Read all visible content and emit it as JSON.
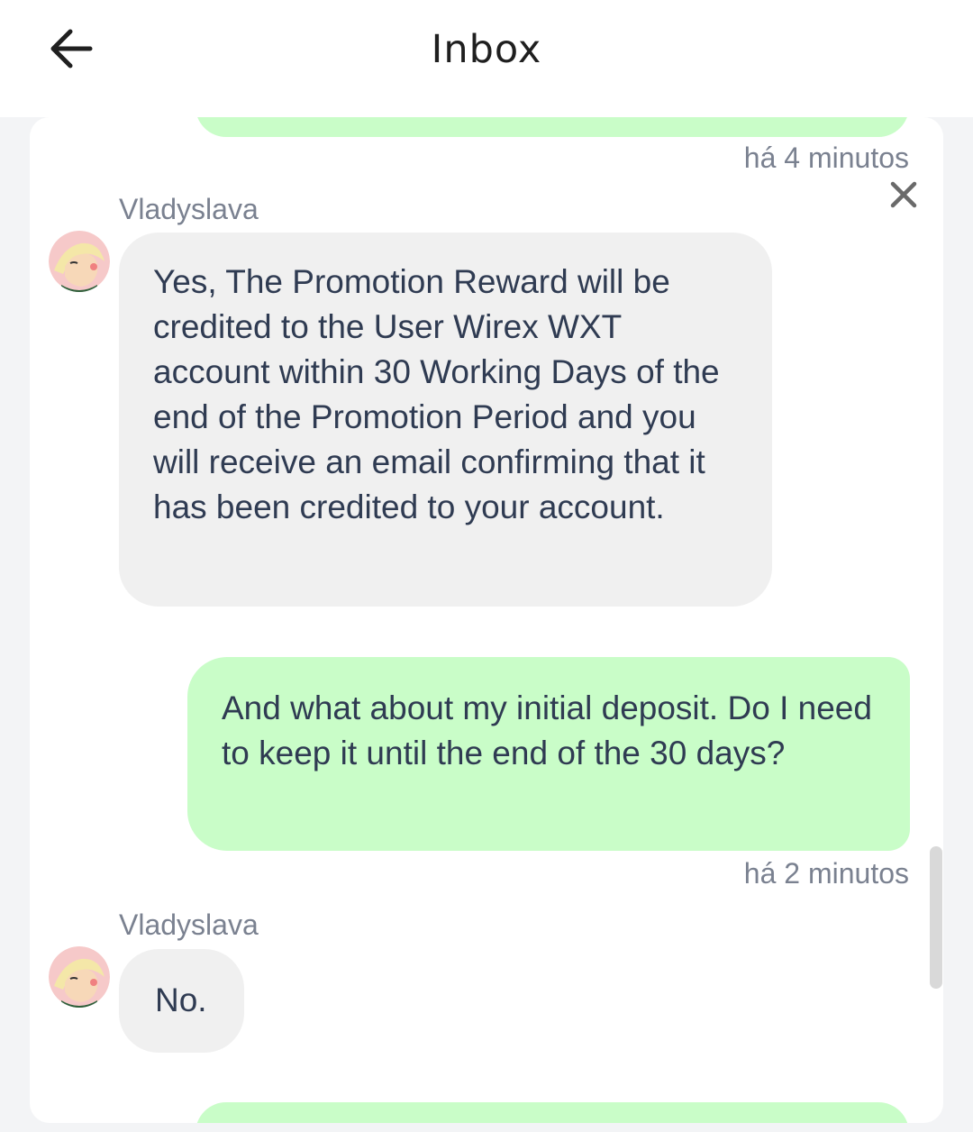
{
  "header": {
    "title": "Inbox",
    "back_icon": "arrow-left-icon"
  },
  "messages": [
    {
      "type": "outgoing",
      "partial": true,
      "timestamp": "há 4 minutos"
    },
    {
      "type": "incoming",
      "sender": "Vladyslava",
      "text": "Yes, The Promotion Reward will be credited to the User Wirex WXT account within 30 Working Days of the end of the Promotion Period and you will receive an email confirming that it has been credited to your account."
    },
    {
      "type": "outgoing",
      "text": "And what about my initial deposit. Do I need to keep it until the end of the 30 days?",
      "timestamp": "há 2 minutos"
    },
    {
      "type": "incoming",
      "sender": "Vladyslava",
      "text": "No."
    },
    {
      "type": "outgoing",
      "partial": true
    }
  ],
  "colors": {
    "outgoing_bubble": "#c9fdc8",
    "incoming_bubble": "#f0f0f0",
    "message_text": "#2f3b52",
    "meta_text": "#7a8190",
    "background": "#f3f4f6"
  }
}
